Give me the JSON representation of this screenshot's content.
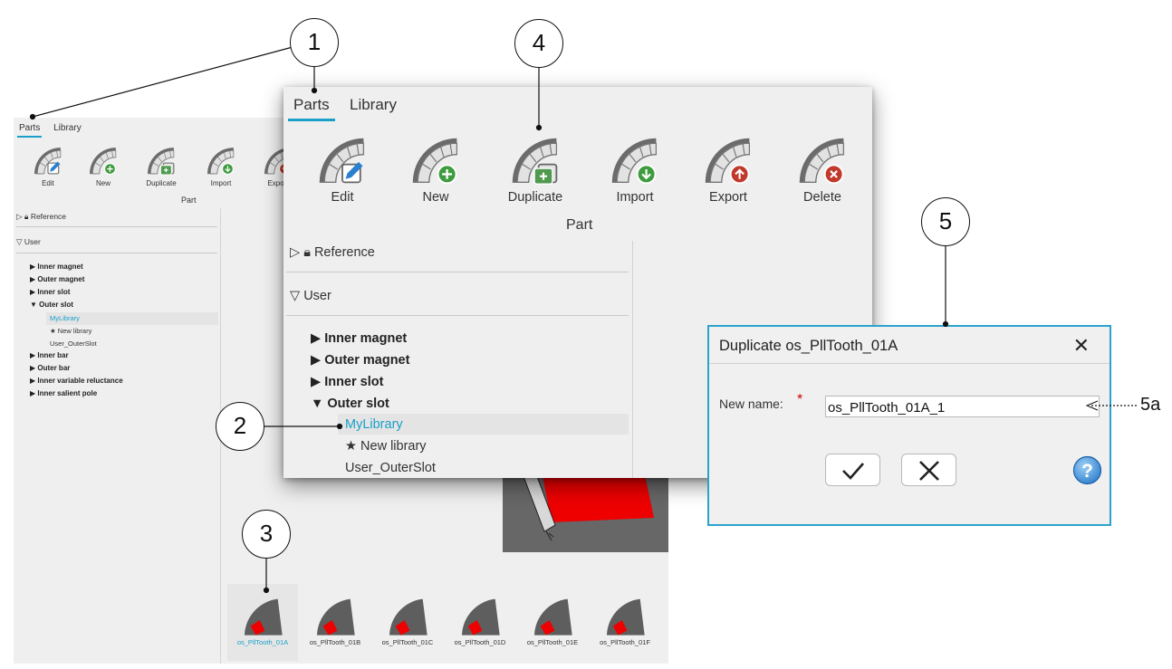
{
  "tabs": [
    "Parts",
    "Library"
  ],
  "toolbar": {
    "buttons": [
      {
        "label": "Edit",
        "icon": "edit-icon"
      },
      {
        "label": "New",
        "icon": "new-icon"
      },
      {
        "label": "Duplicate",
        "icon": "duplicate-icon"
      },
      {
        "label": "Import",
        "icon": "import-icon"
      },
      {
        "label": "Export",
        "icon": "export-icon"
      },
      {
        "label": "Delete",
        "icon": "delete-icon"
      }
    ],
    "group_label": "Part"
  },
  "tree": {
    "reference": "Reference",
    "user": "User",
    "categories": [
      "Inner magnet",
      "Outer magnet",
      "Inner slot",
      "Outer slot",
      "Inner bar",
      "Outer bar",
      "Inner variable reluctance",
      "Inner salient pole"
    ],
    "outer_slot_children": [
      "MyLibrary",
      "★ New library",
      "User_OuterSlot"
    ]
  },
  "thumbnails": [
    "os_PllTooth_01A",
    "os_PllTooth_01B",
    "os_PllTooth_01C",
    "os_PllTooth_01D",
    "os_PllTooth_01E",
    "os_PllTooth_01F"
  ],
  "dialog": {
    "title": "Duplicate os_PllTooth_01A",
    "close": "✕",
    "name_label": "New name:",
    "required_mark": "*",
    "name_value": "os_PllTooth_01A_1",
    "help": "?"
  },
  "callouts": [
    "1",
    "2",
    "3",
    "4",
    "5",
    "5a"
  ],
  "colors": {
    "accent": "#1aa0c8",
    "dialog_border": "#2aa3cc",
    "edit": "#2b7fd0",
    "new": "#3e9b3e",
    "duplicate": "#4f9a4f",
    "import": "#3e9b3e",
    "export": "#c0392b",
    "delete": "#c0392b",
    "part_red": "#ee0000",
    "part_gray": "#606060"
  }
}
